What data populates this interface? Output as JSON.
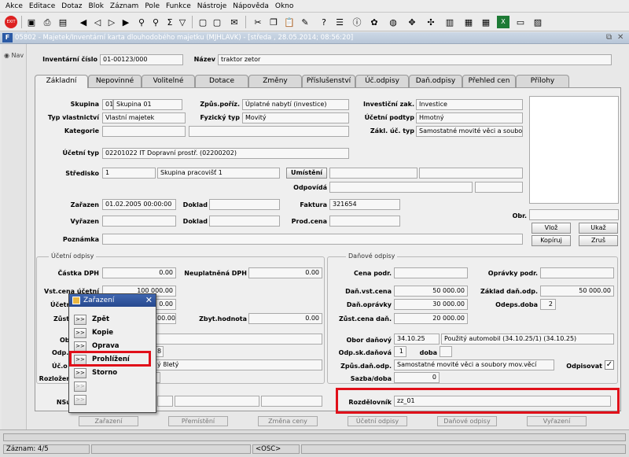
{
  "menu": [
    "Akce",
    "Editace",
    "Dotaz",
    "Blok",
    "Záznam",
    "Pole",
    "Funkce",
    "Nástroje",
    "Nápověda",
    "Okno"
  ],
  "window": {
    "title": "05802 - Majetek/Inventární karta dlouhodobého majetku (MJHLAVK) - [středa , 28.05.2014; 08:56:20]"
  },
  "nav": {
    "label": "Nav"
  },
  "header": {
    "inv_label": "Inventární číslo",
    "inv_value": "01-00123/000",
    "name_label": "Název",
    "name_value": "traktor zetor"
  },
  "tabs": [
    "Základní",
    "Nepovinné",
    "Volitelné",
    "Dotace",
    "Změny",
    "Příslušenství",
    "Úč.odpisy",
    "Daň.odpisy",
    "Přehled cen",
    "Přílohy"
  ],
  "basic": {
    "skupina_label": "Skupina",
    "skupina_code": "01",
    "skupina_name": "Skupina 01",
    "zpusob_label": "Způs.poříz.",
    "zpusob_value": "Úplatné nabytí (investice)",
    "invest_label": "Investiční zak.",
    "invest_value": "Investice",
    "typvl_label": "Typ vlastnictví",
    "typvl_value": "Vlastní majetek",
    "fyz_label": "Fyzický typ",
    "fyz_value": "Movitý",
    "ucpod_label": "Účetní podtyp",
    "ucpod_value": "Hmotný",
    "kat_label": "Kategorie",
    "zakl_label": "Zákl. úč. typ",
    "zakl_value": "Samostatné movité věci a soubory",
    "uctyp_label": "Účetní typ",
    "uctyp_value": "02201022 IT Dopravní prostř. (02200202)",
    "stred_label": "Středisko",
    "stred_code": "1",
    "stred_name": "Skupina pracovišť 1",
    "umist_label": "Umístění",
    "odpov_label": "Odpovídá",
    "zar_label": "Zařazen",
    "zar_value": "01.02.2005 00:00:00",
    "doklad_label": "Doklad",
    "faktura_label": "Faktura",
    "faktura_value": "321654",
    "vyr_label": "Vyřazen",
    "doklad2_label": "Doklad",
    "prod_label": "Prod.cena",
    "pozn_label": "Poznámka",
    "obr_label": "Obr.",
    "btn_vloz": "Vlož",
    "btn_ukaz": "Ukaž",
    "btn_kopiruj": "Kopíruj",
    "btn_zrus": "Zruš"
  },
  "ucetni": {
    "title": "Účetní odpisy",
    "castka_label": "Částka DPH",
    "castka_value": "0.00",
    "neupl_label": "Neuplatněná DPH",
    "neupl_value": "0.00",
    "vstup_label": "Vst.cena účetní",
    "vstup_value": "100 000.00",
    "ucet_label": "Účetn",
    "ucet_value": "0.00",
    "zust_label": "Zůst",
    "zust_value": "00.00",
    "zbyt_label": "Zbyt.hodnota",
    "zbyt_value": "0.00",
    "ob_label": "Ob",
    "odp_label": "Odp.",
    "odp_value": "8",
    "uc_label": "Úč.o",
    "uc_value": "ý 8letý",
    "rozl_label": "Rozložen",
    "ns_label": "NSú"
  },
  "danove": {
    "title": "Daňové odpisy",
    "cena_label": "Cena podr.",
    "opravky_podr_label": "Oprávky podr.",
    "danvst_label": "Daň.vst.cena",
    "danvst_value": "50 000.00",
    "zaklad_label": "Základ daň.odp.",
    "zaklad_value": "50 000.00",
    "danopr_label": "Daň.oprávky",
    "danopr_value": "30 000.00",
    "odeps_label": "Odeps.doba",
    "odeps_value": "2",
    "zustdan_label": "Zůst.cena daň.",
    "zustdan_value": "20 000.00",
    "obor_label": "Obor daňový",
    "obor_code": "34.10.25",
    "obor_value": "Použitý automobil (34.10.25/1) (34.10.25)",
    "odpsk_label": "Odp.sk.daňová",
    "odpsk_value": "1",
    "doba_label": "doba",
    "zpusdan_label": "Způs.daň.odp.",
    "zpusdan_value": "Samostatné movité věci a soubory mov.věcí",
    "odpis_label": "Odpisovat",
    "odpis_check": "✓",
    "sazba_label": "Sazba/doba",
    "sazba_value": "0",
    "rozdel_label": "Rozdělovník",
    "rozdel_value": "zz_01"
  },
  "bottom_buttons": [
    "Zařazení",
    "Přemístění",
    "Změna ceny",
    "Účetní odpisy",
    "Daňové odpisy",
    "Vyřazení"
  ],
  "popup": {
    "title": "Zařazení",
    "items": [
      {
        "btn": ">>",
        "label": "Zpět"
      },
      {
        "btn": ">>",
        "label": "Kopie"
      },
      {
        "btn": ">>",
        "label": "Oprava"
      },
      {
        "btn": ">>",
        "label": "Prohlížení"
      },
      {
        "btn": ">>",
        "label": "Storno"
      },
      {
        "btn": ">>",
        "label": ""
      },
      {
        "btn": ">>",
        "label": ""
      }
    ]
  },
  "status": {
    "record": "Záznam: 4/5",
    "osc": "<OSC>"
  },
  "colors": {
    "highlight": "#e0101a",
    "titlebar": "#b8c6d8",
    "popup_header": "#27498e"
  }
}
